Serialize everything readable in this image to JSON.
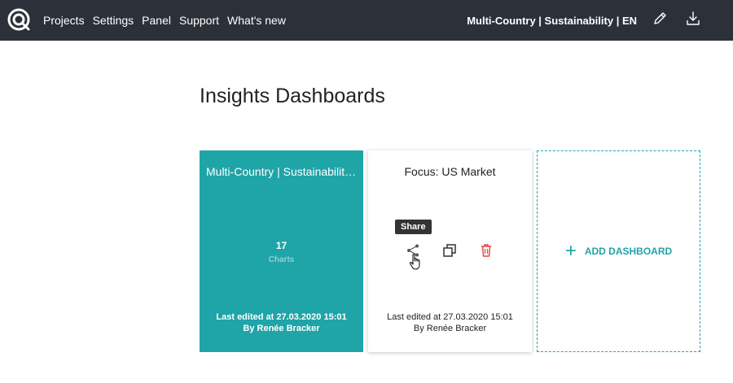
{
  "nav": {
    "items": [
      "Projects",
      "Settings",
      "Panel",
      "Support",
      "What's new"
    ],
    "project_name": "Multi-Country | Sustainability | EN"
  },
  "icons": {
    "logo": "logo-icon",
    "edit": "pencil-icon",
    "download": "download-icon",
    "share": "share-icon",
    "duplicate": "duplicate-icon",
    "delete": "trash-icon",
    "cursor": "hand-cursor-icon"
  },
  "page": {
    "title": "Insights Dashboards"
  },
  "dashboards": [
    {
      "title": "Multi-Country | Sustainability | EN",
      "chart_count": "17",
      "chart_label": "Charts",
      "last_edited": "Last edited at 27.03.2020 15:01",
      "author": "By Renée Bracker"
    },
    {
      "title": "Focus: US Market",
      "tooltip": "Share",
      "last_edited": "Last edited at 27.03.2020 15:01",
      "author": "By Renée Bracker"
    }
  ],
  "add_dashboard": {
    "label": "ADD DASHBOARD",
    "icon": "+"
  },
  "colors": {
    "topbar": "#2b3039",
    "accent": "#1fa4a8",
    "delete": "#e0433d"
  }
}
